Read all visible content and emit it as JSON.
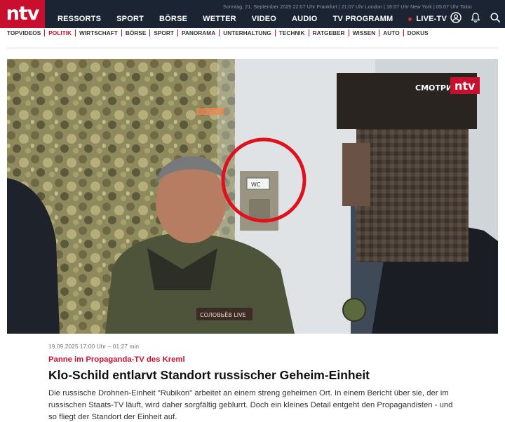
{
  "header": {
    "logo_text": "ntv",
    "clock_line": "Sonntag, 21. September 2025 22:07 Uhr Frankfurt | 21:07 Uhr London | 16:07 Uhr New York | 05:07 Uhr Tokio",
    "nav": [
      "RESSORTS",
      "SPORT",
      "BÖRSE",
      "WETTER",
      "VIDEO",
      "AUDIO",
      "TV PROGRAMM"
    ],
    "live_label": "LIVE-TV",
    "icons": [
      "account-icon",
      "bell-icon",
      "search-icon"
    ],
    "colors": {
      "bar": "#1a2433",
      "logo": "#c8102e"
    }
  },
  "subnav": {
    "items": [
      "TOPVIDEOS",
      "POLITIK",
      "WIRTSCHAFT",
      "BÖRSE",
      "SPORT",
      "PANORAMA",
      "UNTERHALTUNG",
      "TECHNIK",
      "RATGEBER",
      "WISSEN",
      "AUTO",
      "DOKUS"
    ],
    "active": "POLITIK"
  },
  "hero": {
    "tv_logo_left": "СМОТРИ",
    "tv_logo_right": "ntv",
    "sign_text": "WC",
    "patch_text": "СОЛОВЬЁВ LIVE"
  },
  "article": {
    "meta": "19.09.2025 17:00 Uhr – 01:27 min",
    "kicker": "Panne im Propaganda-TV des Kreml",
    "headline": "Klo-Schild entlarvt Standort russischer Geheim-Einheit",
    "teaser": "Die russische Drohnen-Einheit \"Rubikon\" arbeitet an einem streng geheimen Ort. In einem Bericht über sie, der im russischen Staats-TV läuft, wird daher sorgfältig geblurrt. Doch ein kleines Detail entgeht den Propagandisten - und so fliegt der Standort der Einheit auf."
  }
}
